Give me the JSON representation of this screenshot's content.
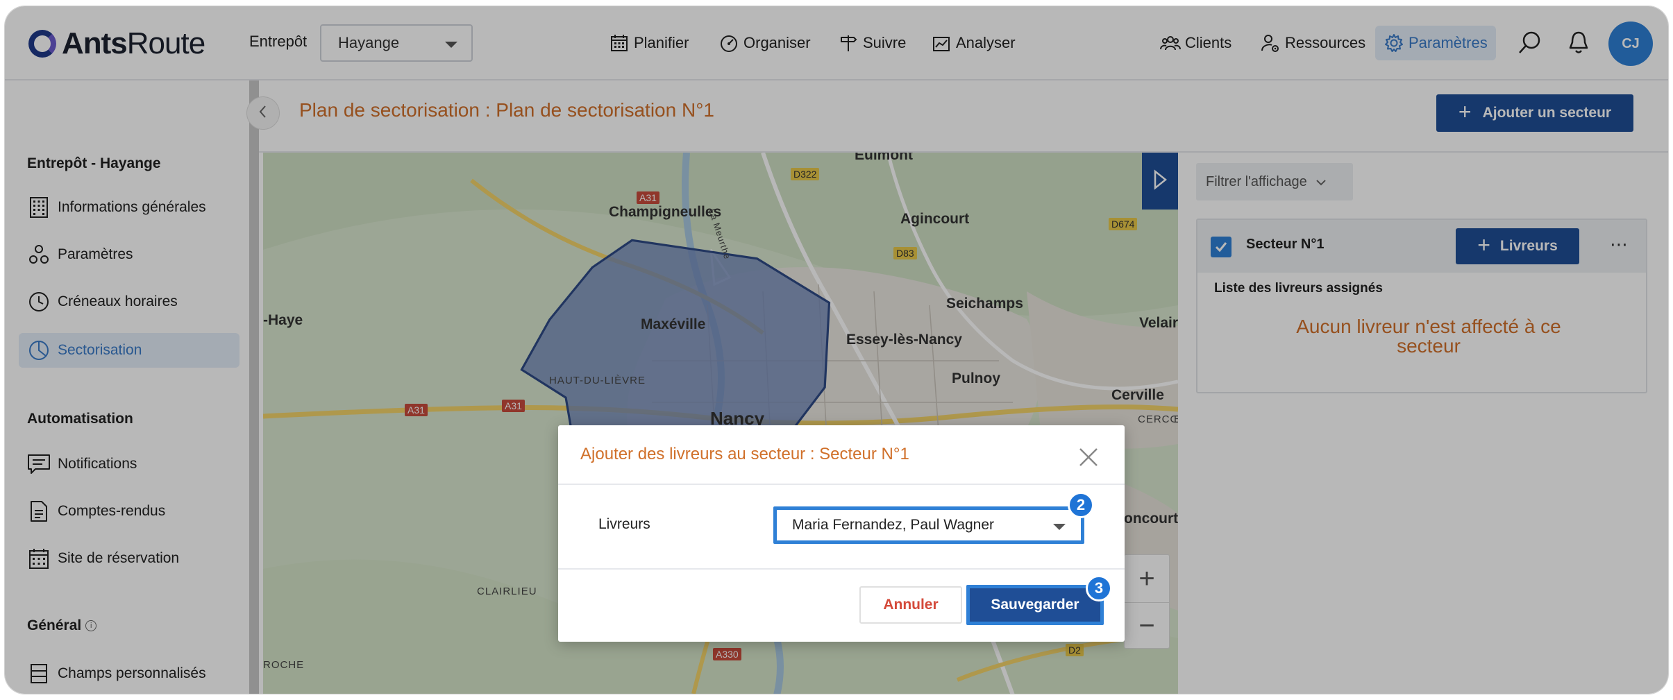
{
  "header": {
    "logo_bold": "Ants",
    "logo_regular": "Route",
    "warehouse_label": "Entrepôt",
    "warehouse_value": "Hayange",
    "nav": [
      {
        "label": "Planifier",
        "icon": "calendar-icon"
      },
      {
        "label": "Organiser",
        "icon": "gauge-icon"
      },
      {
        "label": "Suivre",
        "icon": "signpost-icon"
      },
      {
        "label": "Analyser",
        "icon": "chart-icon"
      },
      {
        "label": "Clients",
        "icon": "users-icon"
      },
      {
        "label": "Ressources",
        "icon": "resource-gear-icon"
      },
      {
        "label": "Paramètres",
        "icon": "gear-icon"
      }
    ],
    "avatar_initials": "CJ"
  },
  "sidebar": {
    "sections": [
      {
        "title": "Entrepôt - Hayange",
        "items": [
          {
            "label": "Informations générales",
            "icon": "building-icon"
          },
          {
            "label": "Paramètres",
            "icon": "settings-nodes-icon"
          },
          {
            "label": "Créneaux horaires",
            "icon": "clock-icon"
          },
          {
            "label": "Sectorisation",
            "icon": "pie-chart-icon",
            "active": true
          }
        ]
      },
      {
        "title": "Automatisation",
        "items": [
          {
            "label": "Notifications",
            "icon": "message-icon"
          },
          {
            "label": "Comptes-rendus",
            "icon": "document-icon"
          },
          {
            "label": "Site de réservation",
            "icon": "calendar-grid-icon"
          }
        ]
      },
      {
        "title": "Général",
        "items": [
          {
            "label": "Champs personnalisés",
            "icon": "list-fields-icon"
          }
        ]
      }
    ]
  },
  "page": {
    "title": "Plan de sectorisation : Plan de sectorisation N°1",
    "add_sector_label": "Ajouter un secteur"
  },
  "map": {
    "places": [
      "Eulmont",
      "Champigneulles",
      "Agincourt",
      "Seichamps",
      "Maxéville",
      "Essey-lès-Nancy",
      "Pulnoy",
      "Velair",
      "Cerville",
      "Nancy",
      "-Haye",
      "oncourt"
    ],
    "small_places": [
      "HAUT-DU-LIÈVRE",
      "CLAIRLIEU",
      "CERCŒU",
      "ROCHE",
      "La Meurthe"
    ],
    "roads": [
      "A31",
      "A31",
      "A31",
      "D322",
      "D83",
      "D674",
      "A330",
      "D2"
    ]
  },
  "panel": {
    "filter_label": "Filtrer l'affichage",
    "sector_name": "Secteur N°1",
    "livreurs_button": "Livreurs",
    "more": "⋯",
    "assigned_title": "Liste des livreurs assignés",
    "empty_message": "Aucun livreur n'est affecté à ce secteur"
  },
  "modal": {
    "title": "Ajouter des livreurs au secteur : Secteur N°1",
    "field_label": "Livreurs",
    "field_value": "Maria Fernandez, Paul Wagner",
    "cancel_label": "Annuler",
    "save_label": "Sauvegarder",
    "badge_select": "2",
    "badge_save": "3"
  },
  "colors": {
    "primary": "#1f4e96",
    "accent_blue": "#2f80d6",
    "orange_text": "#d0702a",
    "cancel_red": "#d44a3a"
  }
}
